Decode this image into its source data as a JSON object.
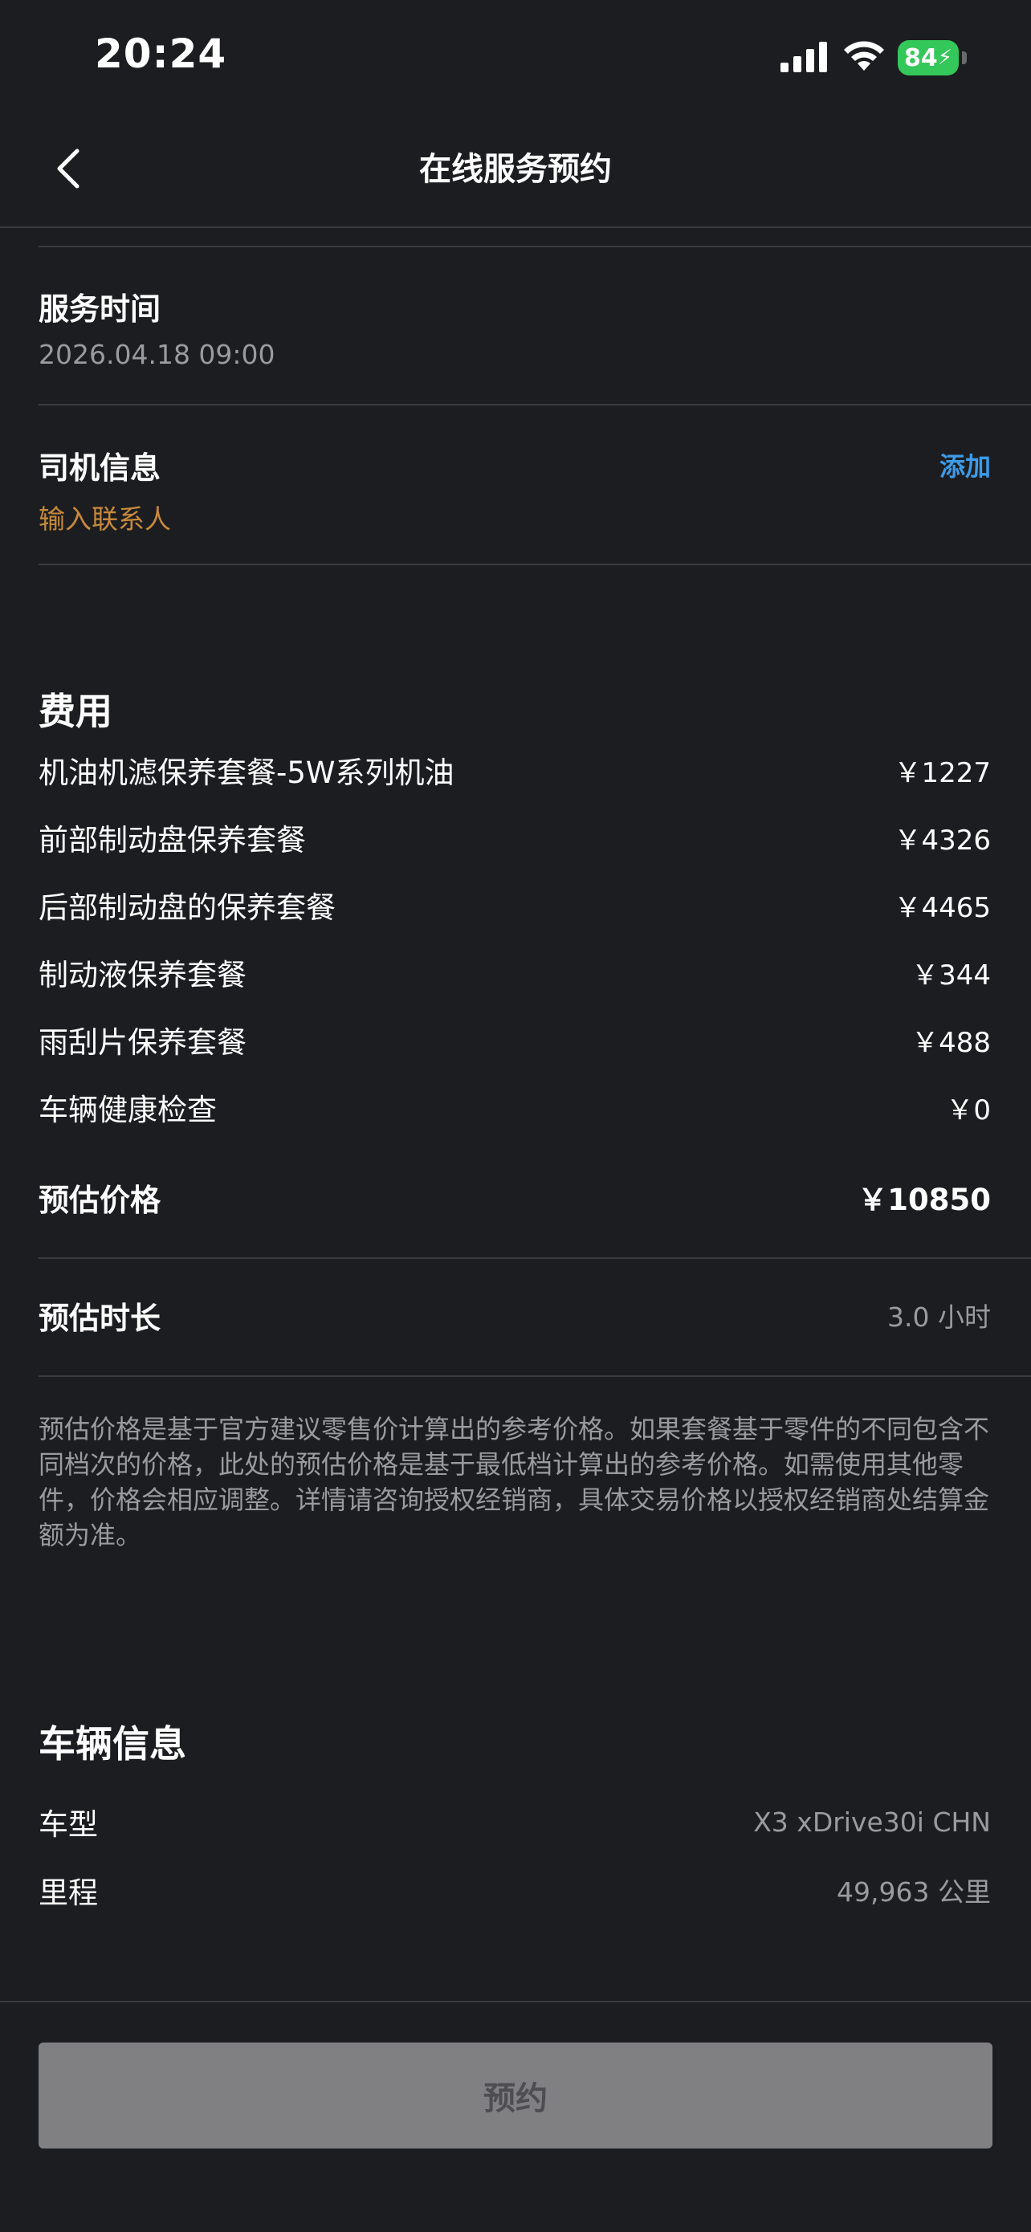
{
  "status_bar": {
    "time": "20:24",
    "battery": "84",
    "icons": [
      "cellular-signal-icon",
      "wifi-icon",
      "battery-charging-icon"
    ]
  },
  "nav": {
    "title": "在线服务预约",
    "back_icon": "chevron-left-icon"
  },
  "service_time": {
    "label": "服务时间",
    "value": "2026.04.18 09:00"
  },
  "driver_info": {
    "label": "司机信息",
    "placeholder": "输入联系人",
    "add_label": "添加"
  },
  "fees": {
    "title": "费用",
    "items": [
      {
        "name": "机油机滤保养套餐-5W系列机油",
        "price": "￥1227"
      },
      {
        "name": "前部制动盘保养套餐",
        "price": "￥4326"
      },
      {
        "name": "后部制动盘的保养套餐",
        "price": "￥4465"
      },
      {
        "name": "制动液保养套餐",
        "price": "￥344"
      },
      {
        "name": "雨刮片保养套餐",
        "price": "￥488"
      },
      {
        "name": "车辆健康检查",
        "price": "￥0"
      }
    ],
    "total_label": "预估价格",
    "total_value": "￥10850",
    "duration_label": "预估时长",
    "duration_value": "3.0 小时",
    "disclaimer": "预估价格是基于官方建议零售价计算出的参考价格。如果套餐基于零件的不同包含不同档次的价格，此处的预估价格是基于最低档计算出的参考价格。如需使用其他零件，价格会相应调整。详情请咨询授权经销商，具体交易价格以授权经销商处结算金额为准。"
  },
  "vehicle": {
    "title": "车辆信息",
    "model_label": "车型",
    "model_value": "X3 xDrive30i CHN",
    "mileage_label": "里程",
    "mileage_value": "49,963 公里"
  },
  "actions": {
    "book_label": "预约"
  },
  "colors": {
    "background": "#1c1d20",
    "accent_link": "#3d9be9",
    "placeholder": "#c88a3b",
    "battery": "#34c759",
    "button_disabled": "#808083"
  }
}
